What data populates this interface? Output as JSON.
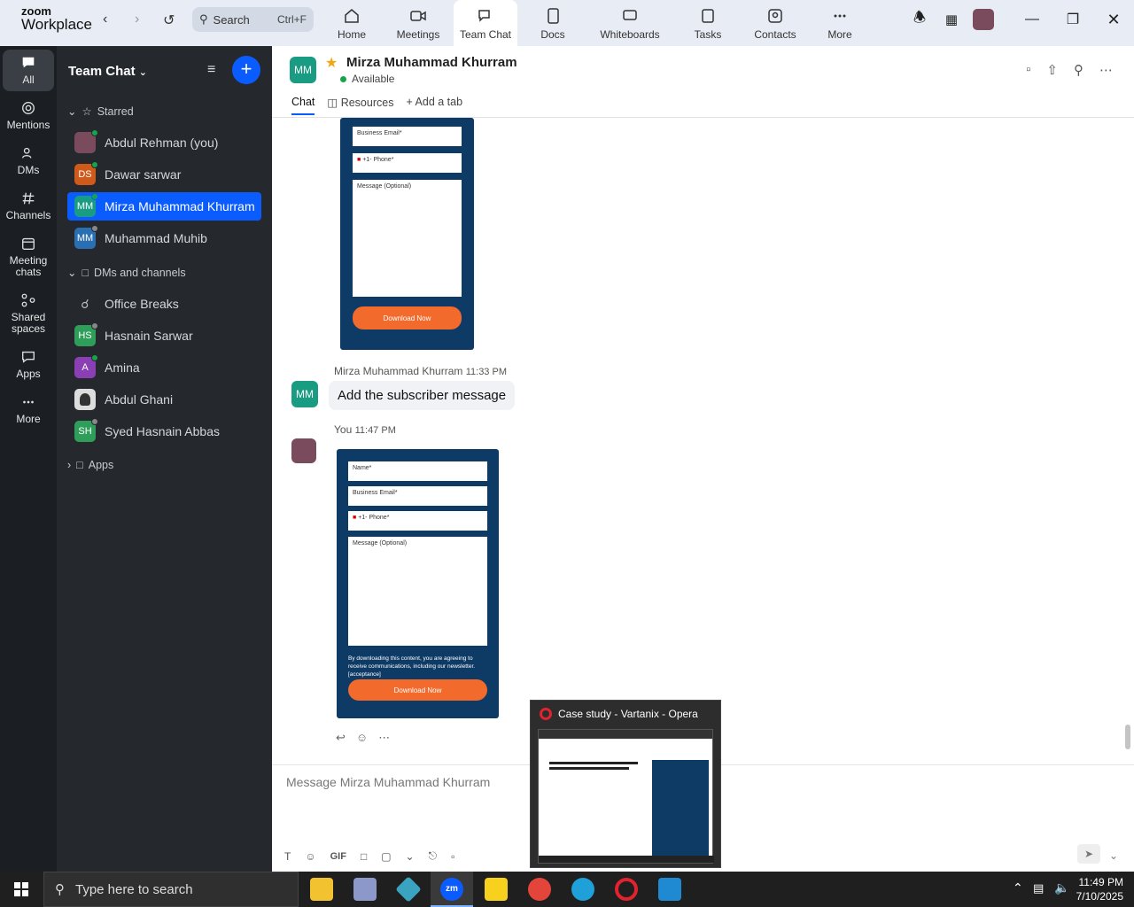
{
  "app": {
    "logo_top": "zoom",
    "logo_bottom": "Workplace"
  },
  "search": {
    "label": "Search",
    "shortcut": "Ctrl+F"
  },
  "tabs": [
    {
      "label": "Home"
    },
    {
      "label": "Meetings"
    },
    {
      "label": "Team Chat"
    },
    {
      "label": "Docs"
    },
    {
      "label": "Whiteboards"
    },
    {
      "label": "Tasks"
    },
    {
      "label": "Contacts"
    },
    {
      "label": "More"
    }
  ],
  "leftnav": [
    {
      "label": "All"
    },
    {
      "label": "Mentions"
    },
    {
      "label": "DMs"
    },
    {
      "label": "Channels"
    },
    {
      "label": "Meeting chats"
    },
    {
      "label": "Shared spaces"
    },
    {
      "label": "Apps"
    },
    {
      "label": "More"
    }
  ],
  "sidebar": {
    "title": "Team Chat",
    "starred_label": "Starred",
    "starred": [
      {
        "name": "Abdul Rehman (you)",
        "initials": "",
        "color": "#7a4b5c"
      },
      {
        "name": "Dawar sarwar",
        "initials": "DS",
        "color": "#d05a1a"
      },
      {
        "name": "Mirza Muhammad Khurram",
        "initials": "MM",
        "color": "#1a9c83"
      },
      {
        "name": "Muhammad Muhib",
        "initials": "MM",
        "color": "#2b6fb3"
      }
    ],
    "dms_label": "DMs and channels",
    "dms": [
      {
        "name": "Office Breaks",
        "initials": "",
        "color": ""
      },
      {
        "name": "Hasnain Sarwar",
        "initials": "HS",
        "color": "#2f9e5a"
      },
      {
        "name": "Amina",
        "initials": "A",
        "color": "#8a3fb5"
      },
      {
        "name": "Abdul Ghani",
        "initials": "",
        "color": "#555"
      },
      {
        "name": "Syed Hasnain Abbas",
        "initials": "SH",
        "color": "#2f9e5a"
      }
    ],
    "apps_label": "Apps"
  },
  "chat": {
    "contact": "Mirza Muhammad Khurram",
    "contact_initials": "MM",
    "status": "Available",
    "subtabs": [
      "Chat",
      "Resources",
      "Add a tab"
    ],
    "form1": {
      "email": "Business Email*",
      "phone_code": "+1-",
      "phone": "Phone*",
      "message": "Message (Optional)",
      "button": "Download Now"
    },
    "msg1": {
      "author": "Mirza Muhammad Khurram",
      "time": "11:33 PM",
      "text": "Add the subscriber message"
    },
    "msg2": {
      "author": "You",
      "time": "11:47 PM"
    },
    "form2": {
      "name": "Name*",
      "email": "Business Email*",
      "phone_code": "+1-",
      "phone": "Phone*",
      "message": "Message (Optional)",
      "consent": "By downloading this content, you are agreeing to receive communications, including our newsletter. [acceptance]",
      "button": "Download Now"
    },
    "composer_placeholder": "Message Mirza Muhammad Khurram",
    "gif_label": "GIF"
  },
  "popup": {
    "title": "Case study - Vartanix - Opera"
  },
  "taskbar": {
    "search_placeholder": "Type here to search",
    "time": "11:49 PM",
    "date": "7/10/2025"
  }
}
